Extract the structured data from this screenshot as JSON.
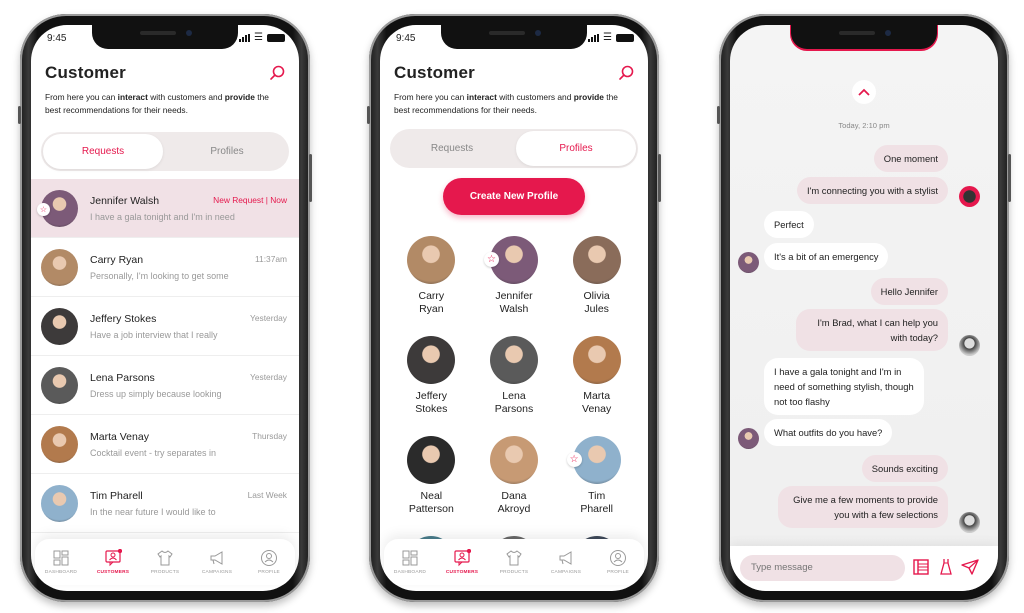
{
  "status_bar": {
    "time": "9:45"
  },
  "screen1": {
    "title": "Customer",
    "desc_parts": [
      "From here you can ",
      "interact",
      " with customers and ",
      "provide",
      " the best recommendations for their needs."
    ],
    "tabs": [
      {
        "label": "Requests",
        "active": true
      },
      {
        "label": "Profiles",
        "active": false
      }
    ],
    "requests": [
      {
        "name": "Jennifer Walsh",
        "preview": "I have a gala tonight and I'm in need",
        "time": "New Request | Now",
        "highlight": true,
        "starred": true,
        "avatar_color": "#7c5a78"
      },
      {
        "name": "Carry Ryan",
        "preview": "Personally, I'm looking to get some",
        "time": "11:37am",
        "avatar_color": "#b28a66"
      },
      {
        "name": "Jeffery Stokes",
        "preview": "Have a job interview that I really",
        "time": "Yesterday",
        "avatar_color": "#3d3a3a"
      },
      {
        "name": "Lena Parsons",
        "preview": "Dress up simply because looking",
        "time": "Yesterday",
        "avatar_color": "#5a5a5a"
      },
      {
        "name": "Marta Venay",
        "preview": "Cocktail event - try separates in",
        "time": "Thursday",
        "avatar_color": "#b27a4d"
      },
      {
        "name": "Tim Pharell",
        "preview": "In the near future I would like to",
        "time": "Last Week",
        "avatar_color": "#8fb1cc"
      }
    ]
  },
  "screen2": {
    "title": "Customer",
    "desc_parts": [
      "From here you can ",
      "interact",
      " with customers and ",
      "provide",
      " the best recommendations for their needs."
    ],
    "tabs": [
      {
        "label": "Requests",
        "active": false
      },
      {
        "label": "Profiles",
        "active": true
      }
    ],
    "create_button": "Create New Profile",
    "profiles": [
      {
        "first": "Carry",
        "last": "Ryan",
        "avatar_color": "#b28a66"
      },
      {
        "first": "Jennifer",
        "last": "Walsh",
        "starred": true,
        "avatar_color": "#7c5a78"
      },
      {
        "first": "Olivia",
        "last": "Jules",
        "avatar_color": "#8a6c5a"
      },
      {
        "first": "Jeffery",
        "last": "Stokes",
        "avatar_color": "#3d3a3a"
      },
      {
        "first": "Lena",
        "last": "Parsons",
        "avatar_color": "#5a5a5a"
      },
      {
        "first": "Marta",
        "last": "Venay",
        "avatar_color": "#b27a4d"
      },
      {
        "first": "Neal",
        "last": "Patterson",
        "avatar_color": "#2b2b2b"
      },
      {
        "first": "Dana",
        "last": "Akroyd",
        "avatar_color": "#c79a74"
      },
      {
        "first": "Tim",
        "last": "Pharell",
        "starred": true,
        "avatar_color": "#8fb1cc"
      }
    ]
  },
  "nav": [
    {
      "label": "DASHBOARD",
      "icon": "dashboard-icon"
    },
    {
      "label": "CUSTOMERS",
      "icon": "customers-icon",
      "active": true,
      "badge": "1"
    },
    {
      "label": "PRODUCTS",
      "icon": "tshirt-icon"
    },
    {
      "label": "CAMPAIGNS",
      "icon": "megaphone-icon"
    },
    {
      "label": "PROFILE",
      "icon": "profile-icon"
    }
  ],
  "chat": {
    "timestamp": "Today, 2:10 pm",
    "messages": [
      {
        "from": "me",
        "text": "One moment"
      },
      {
        "from": "me",
        "text": "I'm connecting you with a stylist",
        "avatar": "bot"
      },
      {
        "from": "them",
        "text": "Perfect"
      },
      {
        "from": "them",
        "text": "It's a bit of an emergency",
        "avatar": "jennifer"
      },
      {
        "from": "me",
        "text": "Hello Jennifer"
      },
      {
        "from": "me",
        "text": "I'm Brad, what I can help you with today?",
        "avatar": "brad"
      },
      {
        "from": "them",
        "text": "I have a gala tonight and I'm in need of something stylish, though not too flashy"
      },
      {
        "from": "them",
        "text": "What outfits do you have?",
        "avatar": "jennifer"
      },
      {
        "from": "me",
        "text": "Sounds exciting"
      },
      {
        "from": "me",
        "text": "Give me a few moments to provide you with a few selections",
        "avatar": "brad"
      }
    ],
    "input_placeholder": "Type message",
    "accent": "#e5184d"
  },
  "colors": {
    "accent": "#e5184d",
    "highlight_row": "#f1e1e6",
    "tab_bg": "#efeaea"
  }
}
